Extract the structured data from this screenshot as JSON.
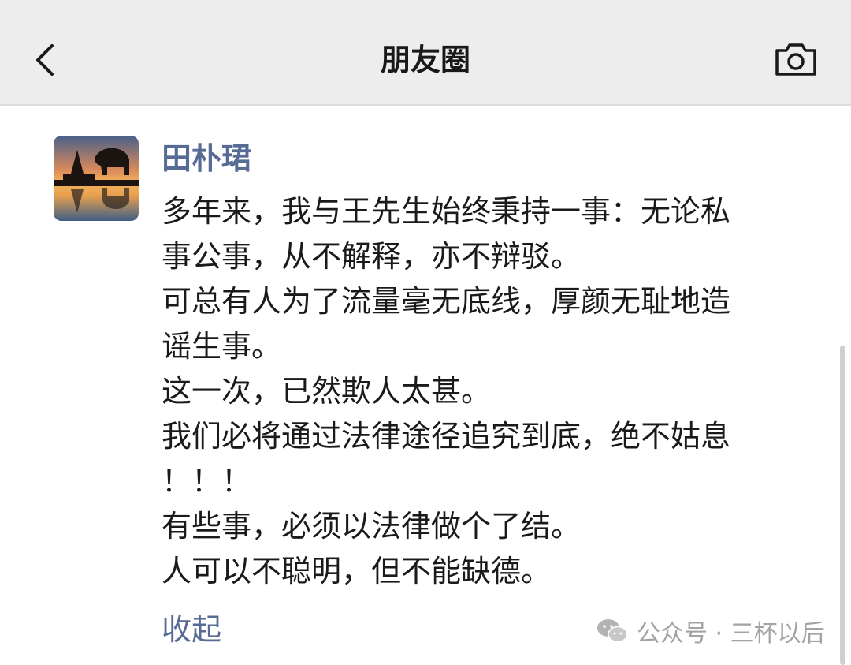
{
  "nav": {
    "title": "朋友圈",
    "back_icon": "chevron-left-icon",
    "camera_icon": "camera-icon"
  },
  "post": {
    "author": "田朴珺",
    "lines": [
      "多年来，我与王先生始终秉持一事：无论私",
      "事公事，从不解释，亦不辩驳。",
      "可总有人为了流量毫无底线，厚颜无耻地造",
      "谣生事。",
      "这一次，已然欺人太甚。",
      "我们必将通过法律途径追究到底，绝不姑息",
      "！！！",
      "有些事，必须以法律做个了结。",
      "人可以不聪明，但不能缺德。"
    ],
    "collapse_label": "收起"
  },
  "watermark": {
    "text": "公众号 · 三杯以后",
    "icon": "wechat-icon"
  },
  "colors": {
    "nav_bg": "#ededed",
    "link": "#576b95",
    "text": "#1a1a1a",
    "watermark": "#a3a3a3"
  }
}
